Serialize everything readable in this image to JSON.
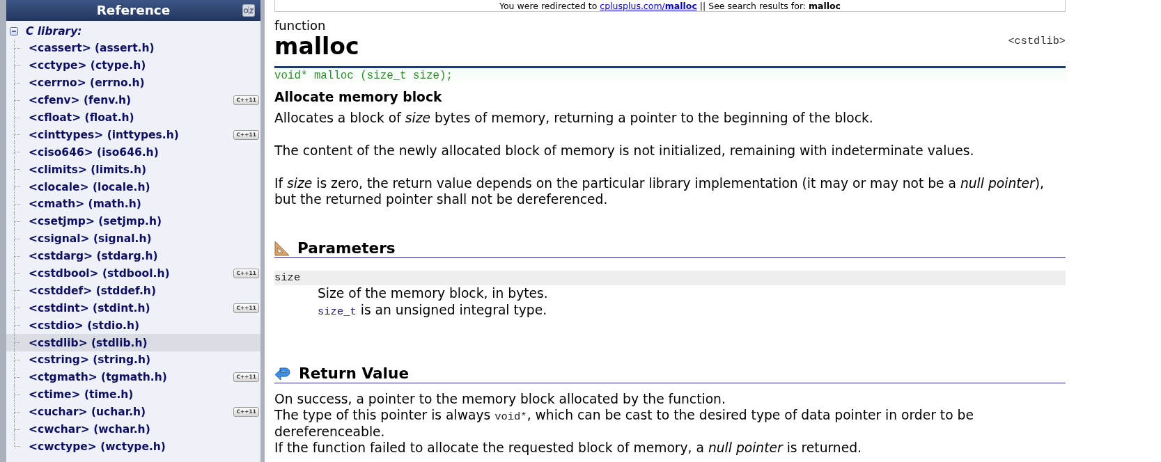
{
  "banner": {
    "text_before": "You were redirected to",
    "link": "cplusplus.com/**malloc**",
    "text_after": "|| See search results for: **malloc**"
  },
  "sidebar": {
    "title": "Reference",
    "tree": [
      {
        "label": "C library:",
        "expanded": true,
        "children": [
          {
            "label": "<cassert> (assert.h)",
            "selected": false
          },
          {
            "label": "<cctype> (ctype.h)",
            "selected": false
          },
          {
            "label": "<cerrno> (errno.h)",
            "selected": false
          },
          {
            "label": "<cfenv> (fenv.h)",
            "selected": false,
            "badge": "C++11"
          },
          {
            "label": "<cfloat> (float.h)",
            "selected": false
          },
          {
            "label": "<cinttypes> (inttypes.h)",
            "selected": false,
            "badge": "C++11"
          },
          {
            "label": "<ciso646> (iso646.h)",
            "selected": false
          },
          {
            "label": "<climits> (limits.h)",
            "selected": false
          },
          {
            "label": "<clocale> (locale.h)",
            "selected": false
          },
          {
            "label": "<cmath> (math.h)",
            "selected": false
          },
          {
            "label": "<csetjmp> (setjmp.h)",
            "selected": false
          },
          {
            "label": "<csignal> (signal.h)",
            "selected": false
          },
          {
            "label": "<cstdarg> (stdarg.h)",
            "selected": false
          },
          {
            "label": "<cstdbool> (stdbool.h)",
            "selected": false,
            "badge": "C++11"
          },
          {
            "label": "<cstddef> (stddef.h)",
            "selected": false
          },
          {
            "label": "<cstdint> (stdint.h)",
            "selected": false,
            "badge": "C++11"
          },
          {
            "label": "<cstdio> (stdio.h)",
            "selected": false
          },
          {
            "label": "<cstdlib> (stdlib.h)",
            "selected": true
          },
          {
            "label": "<cstring> (string.h)",
            "selected": false
          },
          {
            "label": "<ctgmath> (tgmath.h)",
            "selected": false,
            "badge": "C++11"
          },
          {
            "label": "<ctime> (time.h)",
            "selected": false
          },
          {
            "label": "<cuchar> (uchar.h)",
            "selected": false,
            "badge": "C++11"
          },
          {
            "label": "<cwchar> (wchar.h)",
            "selected": false
          },
          {
            "label": "<cwctype> (wctype.h)",
            "selected": false
          }
        ]
      }
    ]
  },
  "doc": {
    "kind_label": "function",
    "name": "malloc",
    "header": "<cstdlib>",
    "prototype": "void* malloc (size_t size);",
    "summary": "Allocate memory block",
    "paragraphs": [
      "Allocates a block of *size* bytes of memory, returning a pointer to the beginning of the block.",
      "The content of the newly allocated block of memory is not initialized, remaining with indeterminate values.",
      "If *size* is zero, the return value depends on the particular library implementation (it may or may not be a *null pointer*), but the returned pointer shall not be dereferenced."
    ],
    "sections": [
      {
        "kind": "parameters",
        "title": "Parameters",
        "params": [
          {
            "name": "size",
            "lines": [
              [
                {
                  "kind": "text",
                  "text": "Size of the memory block, in bytes."
                }
              ],
              [
                {
                  "kind": "code",
                  "text": "size_t"
                },
                {
                  "kind": "text",
                  "text": " is an unsigned integral type."
                }
              ]
            ]
          }
        ]
      },
      {
        "kind": "return",
        "title": "Return Value",
        "lines": [
          [
            {
              "kind": "text",
              "text": "On success, a pointer to the memory block allocated by the function."
            }
          ],
          [
            {
              "kind": "text",
              "text": "The type of this pointer is always "
            },
            {
              "kind": "code",
              "text": "void*"
            },
            {
              "kind": "text",
              "text": ", which can be cast to the desired type of data pointer in order to be dereferenceable."
            }
          ],
          [
            {
              "kind": "text",
              "text": "If the function failed to allocate the requested block of memory, a *null pointer* is returned."
            }
          ]
        ]
      }
    ]
  }
}
